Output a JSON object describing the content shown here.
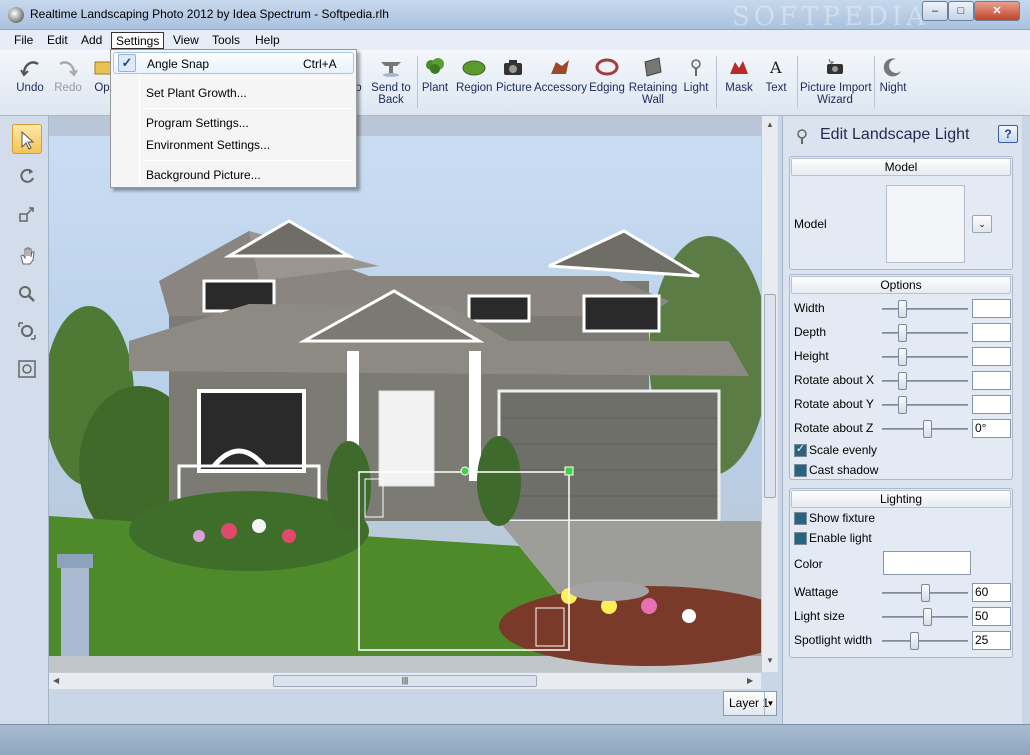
{
  "window": {
    "title": "Realtime Landscaping Photo 2012 by Idea Spectrum - Softpedia.rlh",
    "watermark": "SOFTPEDIA",
    "minimize": "–",
    "maximize": "□",
    "close": "✕"
  },
  "menubar": {
    "items": [
      "File",
      "Edit",
      "Add",
      "Settings",
      "View",
      "Tools",
      "Help"
    ],
    "active": "Settings"
  },
  "toolbar": {
    "items": [
      {
        "label": "Undo",
        "icon": "undo-icon"
      },
      {
        "label": "Redo",
        "icon": "redo-icon",
        "disabled": true
      },
      {
        "label": "Op",
        "icon": "open-icon"
      },
      {
        "label": "to\nt",
        "icon": "bring-to-front-icon"
      },
      {
        "label": "Send to\nBack",
        "icon": "send-to-back-icon"
      },
      {
        "label": "Plant",
        "icon": "plant-icon"
      },
      {
        "label": "Region",
        "icon": "region-icon"
      },
      {
        "label": "Picture",
        "icon": "picture-icon"
      },
      {
        "label": "Accessory",
        "icon": "accessory-icon"
      },
      {
        "label": "Edging",
        "icon": "edging-icon"
      },
      {
        "label": "Retaining\nWall",
        "icon": "retaining-wall-icon"
      },
      {
        "label": "Light",
        "icon": "light-icon"
      },
      {
        "label": "Mask",
        "icon": "mask-icon"
      },
      {
        "label": "Text",
        "icon": "text-icon"
      },
      {
        "label": "Picture Import\nWizard",
        "icon": "wizard-icon"
      },
      {
        "label": "Night",
        "icon": "night-icon"
      }
    ]
  },
  "settings_menu": {
    "items": [
      {
        "label": "Angle Snap",
        "shortcut": "Ctrl+A",
        "checked": true
      },
      {
        "label": "Set Plant Growth...",
        "shortcut": ""
      },
      {
        "label": "Program Settings...",
        "shortcut": ""
      },
      {
        "label": "Environment Settings...",
        "shortcut": ""
      },
      {
        "label": "Background Picture...",
        "shortcut": ""
      }
    ]
  },
  "left_tools": [
    "select-tool-icon",
    "rotate-tool-icon",
    "scale-tool-icon",
    "pan-hand-icon",
    "zoom-icon",
    "zoom-extents-icon",
    "zoom-window-icon"
  ],
  "layer": {
    "label": "Layer 1"
  },
  "panel": {
    "title": "Edit Landscape Light",
    "help": "?",
    "model": {
      "header": "Model",
      "label": "Model",
      "dropdown": "⌄"
    },
    "options": {
      "header": "Options",
      "sliders": [
        {
          "label": "Width",
          "value": "",
          "level": 0.2
        },
        {
          "label": "Depth",
          "value": "",
          "level": 0.2
        },
        {
          "label": "Height",
          "value": "",
          "level": 0.2
        },
        {
          "label": "Rotate about X",
          "value": "",
          "level": 0.2
        },
        {
          "label": "Rotate about Y",
          "value": "",
          "level": 0.2
        },
        {
          "label": "Rotate about Z",
          "value": "0°",
          "level": 0.5
        }
      ],
      "scale_evenly": {
        "label": "Scale evenly",
        "checked": true
      },
      "cast_shadow": {
        "label": "Cast shadow",
        "checked": true
      }
    },
    "lighting": {
      "header": "Lighting",
      "show_fixture": {
        "label": "Show fixture",
        "checked": true
      },
      "enable_light": {
        "label": "Enable light",
        "checked": true
      },
      "color_label": "Color",
      "sliders": [
        {
          "label": "Wattage",
          "value": "60",
          "level": 0.48
        },
        {
          "label": "Light size",
          "value": "50",
          "level": 0.5
        },
        {
          "label": "Spotlight width",
          "value": "25",
          "level": 0.34
        }
      ]
    }
  },
  "colors": {
    "menu_check": "#1f4a8a",
    "active_tool": "#f5c35a",
    "title_text": "#2a2a50"
  }
}
